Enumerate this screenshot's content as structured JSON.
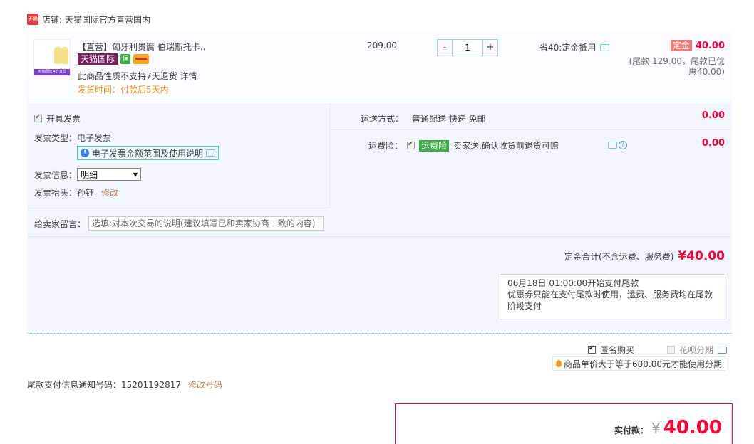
{
  "shop": {
    "label": "店铺:",
    "name": "天猫国际官方直营国内",
    "logo_text": "天猫"
  },
  "item": {
    "title": "【直营】匈牙利贵腐 伯瑞斯托卡..",
    "thumb_tag": "天猫国际官方直营",
    "badge_tmall": "天猫国际",
    "no_return": "此商品性质不支持7天退货 详情",
    "ship_time": "发货时间：付款后5天内",
    "price": "209.00",
    "qty_minus": "-",
    "qty_value": "1",
    "qty_plus": "+",
    "save_text": "省40:定金抵用",
    "deposit_badge": "定金",
    "deposit_amount": "40.00",
    "tail_note": "(尾款 129.00，尾款已优惠40.00)"
  },
  "invoice": {
    "open_label": "开具发票",
    "type_label": "发票类型：电子发票",
    "help_text": "电子发票金额范围及使用说明",
    "info_label": "发票信息：",
    "info_value": "明细",
    "head_label": "发票抬头：孙钰",
    "head_edit": "修改"
  },
  "shipping": {
    "method_label": "运送方式：",
    "method_value": "普通配送 快递 免邮",
    "fee": "0.00",
    "insure_label": "运费险：",
    "insure_badge": "运费险",
    "insure_text": "卖家送,确认收货前退货可赔",
    "insure_fee": "0.00"
  },
  "message": {
    "label": "给卖家留言：",
    "placeholder": "选填:对本次交易的说明(建议填写已和卖家协商一致的内容)"
  },
  "totals": {
    "deposit_label": "定金合计(不含运费、服务费)",
    "deposit_amount": "¥40.00",
    "pay_note_line1": "06月18日 01:00:00开始支付尾款",
    "pay_note_line2": "优惠券只能在支付尾款时使用，运费、服务费均在尾款阶段支付"
  },
  "options": {
    "anon_label": "匿名购买",
    "huabei_label": "花呗分期",
    "installment_note": "商品单价大于等于600.00元才能使用分期"
  },
  "tail_notify": {
    "text": "尾款支付信息通知号码：15201192817",
    "edit": "修改号码"
  },
  "final": {
    "label": "实付款：",
    "yen": "¥",
    "amount": "40.00"
  }
}
